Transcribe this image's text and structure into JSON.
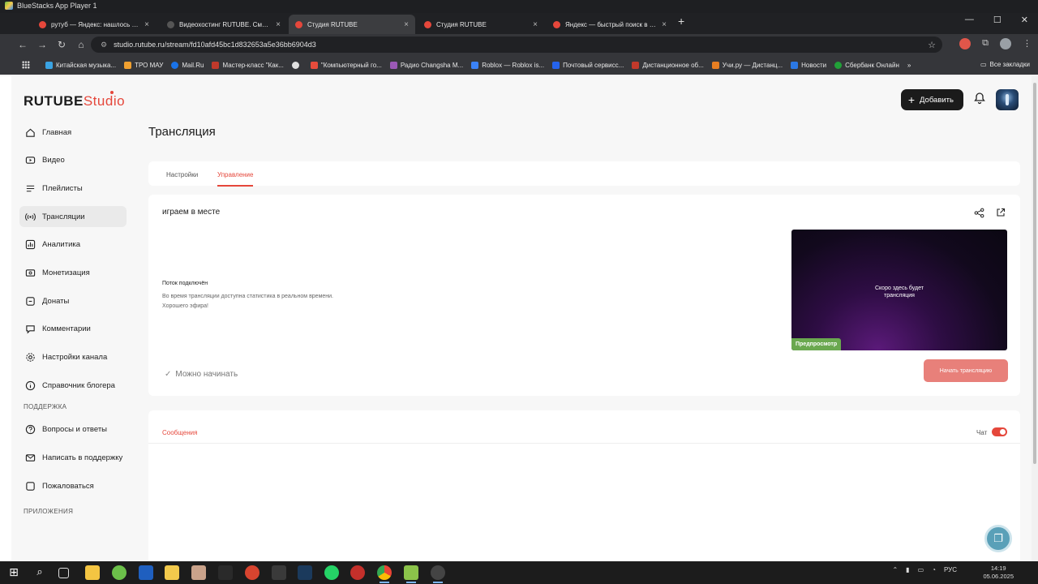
{
  "window": {
    "app_title": "BlueStacks App Player 1"
  },
  "browser": {
    "tabs": [
      {
        "label": "рутуб — Яндекс: нашлось 3 м...",
        "color": "#e5473b",
        "active": false
      },
      {
        "label": "Видеохостинг RUTUBE. Смотр...",
        "color": "#2b2b2b",
        "active": false
      },
      {
        "label": "Студия RUTUBE",
        "color": "#e5473b",
        "active": true
      },
      {
        "label": "Студия RUTUBE",
        "color": "#e5473b",
        "active": false
      },
      {
        "label": "Яндекс — быстрый поиск в и...",
        "color": "#e5473b",
        "active": false
      }
    ],
    "new_tab": "+",
    "url": "studio.rutube.ru/stream/fd10afd45bc1d832653a5e36bb6904d3",
    "bookmarks": [
      {
        "label": "Китайская музыка...",
        "color": "#3aa3e3"
      },
      {
        "label": "ТРО МАУ",
        "color": "#f0a030"
      },
      {
        "label": "Mail.Ru",
        "color": "#1a73e8"
      },
      {
        "label": "Мастер-класс \"Как...",
        "color": "#c0392b"
      },
      {
        "label": "",
        "color": "#e0e0e0"
      },
      {
        "label": "\"Компьютерный го...",
        "color": "#e74c3c"
      },
      {
        "label": "Радио Changsha M...",
        "color": "#9b59b6"
      },
      {
        "label": "Roblox — Roblox is...",
        "color": "#3b82f6"
      },
      {
        "label": "Почтовый сервисс...",
        "color": "#2563eb"
      },
      {
        "label": "Дистанционное об...",
        "color": "#c0392b"
      },
      {
        "label": "Учи.ру — Дистанц...",
        "color": "#e67e22"
      },
      {
        "label": "Новости",
        "color": "#2b78e4"
      },
      {
        "label": "Сбербанк Онлайн",
        "color": "#21a038"
      }
    ],
    "bookmarks_more": "»",
    "all_bookmarks": "Все закладки"
  },
  "studio": {
    "logo_main": "RUTUBE",
    "logo_studio": "Studio",
    "add_button": "Добавить",
    "sidebar": [
      {
        "label": "Главная",
        "icon": "home-icon",
        "active": false
      },
      {
        "label": "Видео",
        "icon": "video-icon",
        "active": false
      },
      {
        "label": "Плейлисты",
        "icon": "playlist-icon",
        "active": false
      },
      {
        "label": "Трансляции",
        "icon": "broadcast-icon",
        "active": true
      },
      {
        "label": "Аналитика",
        "icon": "analytics-icon",
        "active": false
      },
      {
        "label": "Монетизация",
        "icon": "monetization-icon",
        "active": false
      },
      {
        "label": "Донаты",
        "icon": "donate-icon",
        "active": false
      },
      {
        "label": "Комментарии",
        "icon": "comments-icon",
        "active": false
      },
      {
        "label": "Настройки канала",
        "icon": "settings-icon",
        "active": false
      },
      {
        "label": "Справочник блогера",
        "icon": "info-icon",
        "active": false
      }
    ],
    "support_section": "ПОДДЕРЖКА",
    "support_items": [
      {
        "label": "Вопросы и ответы",
        "icon": "help-icon"
      },
      {
        "label": "Написать в поддержку",
        "icon": "mail-icon"
      },
      {
        "label": "Пожаловаться",
        "icon": "flag-icon"
      }
    ],
    "apps_section": "ПРИЛОЖЕНИЯ",
    "page_title": "Трансляция",
    "page_tabs": [
      {
        "label": "Настройки",
        "active": false
      },
      {
        "label": "Управление",
        "active": true
      }
    ],
    "stream": {
      "name": "играем в месте",
      "status_title": "Поток подключён",
      "status_line1": "Во время трансляции доступна статистика в реальном времени.",
      "status_line2": "Хорошего эфира!",
      "ready_text": "Можно начинать",
      "preview_line1": "Скоро здесь будет",
      "preview_line2": "трансляция",
      "preview_badge": "Предпросмотр",
      "start_button": "Начать трансляцию"
    },
    "chat": {
      "messages_tab": "Сообщения",
      "chat_label": "Чат",
      "chat_enabled": true
    },
    "accent_color": "#e5473b"
  },
  "taskbar": {
    "lang": "РУС",
    "time": "14:19",
    "date": "05.06.2025"
  }
}
